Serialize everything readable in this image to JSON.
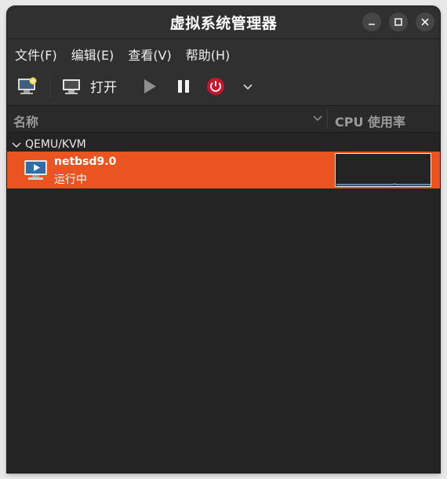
{
  "window": {
    "title": "虚拟系统管理器"
  },
  "menu": [
    {
      "label": "文件(F)"
    },
    {
      "label": "编辑(E)"
    },
    {
      "label": "查看(V)"
    },
    {
      "label": "帮助(H)"
    }
  ],
  "toolbar": {
    "open_label": "打开"
  },
  "columns": {
    "name": "名称",
    "cpu": "CPU 使用率"
  },
  "connection": {
    "label": "QEMU/KVM"
  },
  "vms": [
    {
      "name": "netbsd9.0",
      "status": "运行中",
      "cpu_usage_fraction": 0.02
    }
  ],
  "colors": {
    "selection": "#e95420",
    "power_button": "#c7162b",
    "cpu_line": "#7fa9c9"
  },
  "icons": {
    "new_vm": "new-vm-icon",
    "open": "monitor-icon",
    "run": "play-icon",
    "pause": "pause-icon",
    "power": "power-icon",
    "dropdown": "chevron-down-icon",
    "vm": "vm-running-icon"
  }
}
